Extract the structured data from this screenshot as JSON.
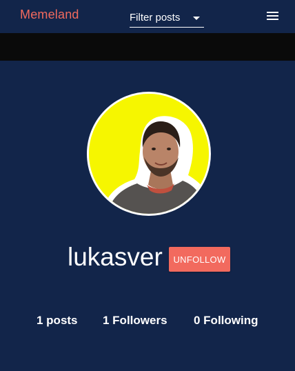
{
  "navbar": {
    "brand": "Memeland",
    "filter_label": "Filter posts",
    "menu_icon": "hamburger-menu-icon"
  },
  "profile": {
    "username": "lukasver",
    "follow_button_label": "UNFOLLOW",
    "avatar_icon": "profile-photo"
  },
  "stats": {
    "posts": "1 posts",
    "followers": "1 Followers",
    "following": "0 Following"
  },
  "colors": {
    "background": "#12254a",
    "accent": "#f26a5e",
    "text": "#ffffff",
    "band": "#0a0a0a",
    "avatar_background": "#f6f600"
  }
}
